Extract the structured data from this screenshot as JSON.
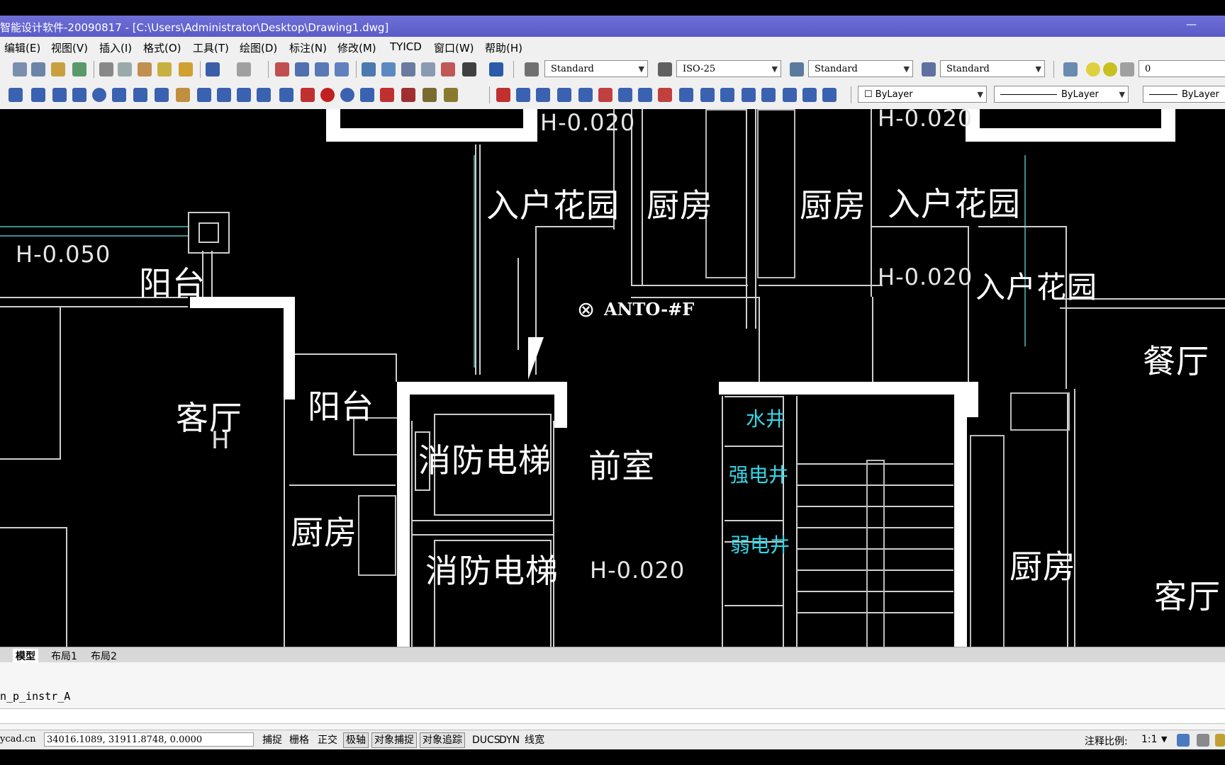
{
  "window": {
    "title": "智能设计软件-20090817 - [C:\\Users\\Administrator\\Desktop\\Drawing1.dwg]",
    "minimize_glyph": "—"
  },
  "menu": [
    "编辑(E)",
    "视图(V)",
    "插入(I)",
    "格式(O)",
    "工具(T)",
    "绘图(D)",
    "标注(N)",
    "修改(M)",
    "TYICD",
    "窗口(W)",
    "帮助(H)"
  ],
  "toolbar": {
    "text_style": "Standard",
    "dim_style": "ISO-25",
    "table_style": "Standard",
    "multileader_style": "Standard",
    "layer_value": "0",
    "color": "ByLayer",
    "linetype": "ByLayer",
    "lineweight": "ByLayer"
  },
  "drawing": {
    "rooms": {
      "entry_garden_1": "入户花园",
      "kitchen_1": "厨房",
      "kitchen_2": "厨房",
      "entry_garden_2": "入户花园",
      "entry_garden_3": "入户花园",
      "balcony_1": "阳台",
      "living_room": "客厅",
      "balcony_2": "阳台",
      "fire_elevator_1": "消防电梯",
      "front_room": "前室",
      "dining_room": "餐厅",
      "kitchen_3": "厨房",
      "fire_elevator_2": "消防电梯",
      "kitchen_4": "厨房",
      "living_room_2": "客厅",
      "living_h": "H"
    },
    "shafts": {
      "water": "水井",
      "strong": "强电井",
      "weak": "弱电井"
    },
    "levels": {
      "l1": "H-0.020",
      "l2": "H-0.020",
      "l3": "H-0.050",
      "l4": "H-0.020",
      "l5": "H-0.020"
    },
    "antenna": "ANTO-#F"
  },
  "tabs": [
    "模型",
    "布局1",
    "布局2"
  ],
  "command_line": "n_p_instr_A",
  "status": {
    "site": "ycad.cn",
    "coordinates": "34016.1089,  31911.8748,  0.0000",
    "buttons": [
      "捕捉",
      "栅格",
      "正交",
      "极轴",
      "对象捕捉",
      "对象追踪",
      "DUCS",
      "DYN",
      "线宽"
    ],
    "annotation_scale_label": "注释比例:",
    "annotation_scale_value": "1:1"
  },
  "colors": {
    "titlebar": "#5b5bc8",
    "drawing_bg": "#000000",
    "shaft_text": "#33d6e6"
  }
}
